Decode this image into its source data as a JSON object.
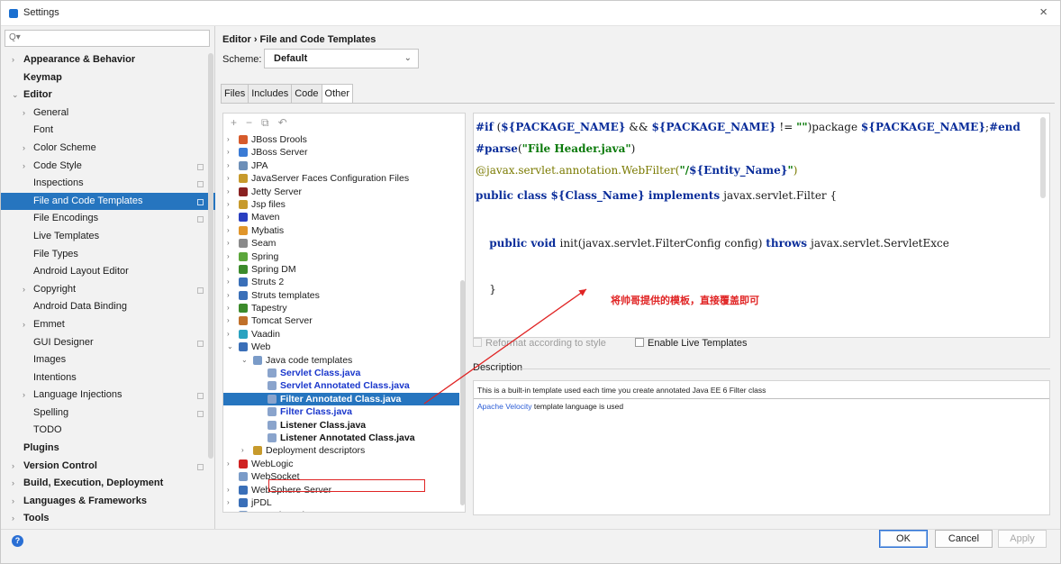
{
  "window": {
    "title": "Settings",
    "close": "×"
  },
  "search": {
    "icon": "Q▾",
    "placeholder": ""
  },
  "nav": [
    {
      "label": "Appearance & Behavior",
      "level": 0,
      "arrow": "›",
      "bold": true
    },
    {
      "label": "Keymap",
      "level": 0,
      "arrow": "",
      "bold": true
    },
    {
      "label": "Editor",
      "level": 0,
      "arrow": "⌄",
      "bold": true
    },
    {
      "label": "General",
      "level": 1,
      "arrow": "›"
    },
    {
      "label": "Font",
      "level": 1,
      "arrow": ""
    },
    {
      "label": "Color Scheme",
      "level": 1,
      "arrow": "›"
    },
    {
      "label": "Code Style",
      "level": 1,
      "arrow": "›",
      "copy": true
    },
    {
      "label": "Inspections",
      "level": 1,
      "arrow": "",
      "copy": true
    },
    {
      "label": "File and Code Templates",
      "level": 1,
      "arrow": "",
      "copy": true,
      "selected": true
    },
    {
      "label": "File Encodings",
      "level": 1,
      "arrow": "",
      "copy": true
    },
    {
      "label": "Live Templates",
      "level": 1,
      "arrow": ""
    },
    {
      "label": "File Types",
      "level": 1,
      "arrow": ""
    },
    {
      "label": "Android Layout Editor",
      "level": 1,
      "arrow": ""
    },
    {
      "label": "Copyright",
      "level": 1,
      "arrow": "›",
      "copy": true
    },
    {
      "label": "Android Data Binding",
      "level": 1,
      "arrow": ""
    },
    {
      "label": "Emmet",
      "level": 1,
      "arrow": "›"
    },
    {
      "label": "GUI Designer",
      "level": 1,
      "arrow": "",
      "copy": true
    },
    {
      "label": "Images",
      "level": 1,
      "arrow": ""
    },
    {
      "label": "Intentions",
      "level": 1,
      "arrow": ""
    },
    {
      "label": "Language Injections",
      "level": 1,
      "arrow": "›",
      "copy": true
    },
    {
      "label": "Spelling",
      "level": 1,
      "arrow": "",
      "copy": true
    },
    {
      "label": "TODO",
      "level": 1,
      "arrow": ""
    },
    {
      "label": "Plugins",
      "level": 0,
      "arrow": "",
      "bold": true
    },
    {
      "label": "Version Control",
      "level": 0,
      "arrow": "›",
      "bold": true,
      "copy": true
    },
    {
      "label": "Build, Execution, Deployment",
      "level": 0,
      "arrow": "›",
      "bold": true
    },
    {
      "label": "Languages & Frameworks",
      "level": 0,
      "arrow": "›",
      "bold": true
    },
    {
      "label": "Tools",
      "level": 0,
      "arrow": "›",
      "bold": true
    }
  ],
  "header": {
    "breadcrumb": "Editor  ›  File and Code Templates",
    "scheme_label": "Scheme:",
    "scheme_value": "Default",
    "scheme_chevron": "⌄"
  },
  "tabs": [
    "Files",
    "Includes",
    "Code",
    "Other"
  ],
  "active_tab": "Other",
  "tree_toolbar": [
    "+",
    "−",
    "⧉",
    "↶"
  ],
  "tree": [
    {
      "label": "JBoss Drools",
      "level": 0,
      "arrow": "›",
      "icon_color": "#d65a2b"
    },
    {
      "label": "JBoss Server",
      "level": 0,
      "arrow": "›",
      "icon_color": "#3a7bd5"
    },
    {
      "label": "JPA",
      "level": 0,
      "arrow": "›",
      "icon_color": "#6d8fb8"
    },
    {
      "label": "JavaServer Faces Configuration Files",
      "level": 0,
      "arrow": "›",
      "icon_color": "#c79a2c"
    },
    {
      "label": "Jetty Server",
      "level": 0,
      "arrow": "›",
      "icon_color": "#8a2222"
    },
    {
      "label": "Jsp files",
      "level": 0,
      "arrow": "›",
      "icon_color": "#c79a2c"
    },
    {
      "label": "Maven",
      "level": 0,
      "arrow": "›",
      "icon_color": "#2a3fc0"
    },
    {
      "label": "Mybatis",
      "level": 0,
      "arrow": "›",
      "icon_color": "#e0952a"
    },
    {
      "label": "Seam",
      "level": 0,
      "arrow": "›",
      "icon_color": "#8a8a8a"
    },
    {
      "label": "Spring",
      "level": 0,
      "arrow": "›",
      "icon_color": "#5ba63b"
    },
    {
      "label": "Spring DM",
      "level": 0,
      "arrow": "›",
      "icon_color": "#3b8a2b"
    },
    {
      "label": "Struts 2",
      "level": 0,
      "arrow": "›",
      "icon_color": "#3a6fb8"
    },
    {
      "label": "Struts templates",
      "level": 0,
      "arrow": "›",
      "icon_color": "#3a6fb8"
    },
    {
      "label": "Tapestry",
      "level": 0,
      "arrow": "›",
      "icon_color": "#3b8a2b"
    },
    {
      "label": "Tomcat Server",
      "level": 0,
      "arrow": "›",
      "icon_color": "#c0702a"
    },
    {
      "label": "Vaadin",
      "level": 0,
      "arrow": "›",
      "icon_color": "#2aa2c0"
    },
    {
      "label": "Web",
      "level": 0,
      "arrow": "⌄",
      "icon_color": "#3a6fb8"
    },
    {
      "label": "Java code templates",
      "level": 1,
      "arrow": "⌄",
      "icon_color": "#7a9bc8"
    },
    {
      "label": "Servlet Class.java",
      "level": 2,
      "arrow": "",
      "icon_color": "#8aa4cc",
      "kind": "file"
    },
    {
      "label": "Servlet Annotated Class.java",
      "level": 2,
      "arrow": "",
      "icon_color": "#8aa4cc",
      "kind": "file"
    },
    {
      "label": "Filter Annotated Class.java",
      "level": 2,
      "arrow": "",
      "icon_color": "#8aa4cc",
      "kind": "file",
      "selected": true
    },
    {
      "label": "Filter Class.java",
      "level": 2,
      "arrow": "",
      "icon_color": "#8aa4cc",
      "kind": "file"
    },
    {
      "label": "Listener Class.java",
      "level": 2,
      "arrow": "",
      "icon_color": "#8aa4cc",
      "kind": "bfile"
    },
    {
      "label": "Listener Annotated Class.java",
      "level": 2,
      "arrow": "",
      "icon_color": "#8aa4cc",
      "kind": "bfile"
    },
    {
      "label": "Deployment descriptors",
      "level": 1,
      "arrow": "›",
      "icon_color": "#c79a2c"
    },
    {
      "label": "WebLogic",
      "level": 0,
      "arrow": "›",
      "icon_color": "#d02222"
    },
    {
      "label": "WebSocket",
      "level": 0,
      "arrow": "",
      "icon_color": "#7a9bc8"
    },
    {
      "label": "WebSphere Server",
      "level": 0,
      "arrow": "›",
      "icon_color": "#3a6fb8"
    },
    {
      "label": "jPDL",
      "level": 0,
      "arrow": "›",
      "icon_color": "#3a6fb8"
    },
    {
      "label": "restwebservices",
      "level": 0,
      "arrow": "›",
      "icon_color": "#7a9bc8"
    }
  ],
  "editor": {
    "lines": [
      {
        "parts": [
          [
            "kw",
            "#if"
          ],
          [
            "",
            " ("
          ],
          [
            "kw",
            "${PACKAGE_NAME}"
          ],
          [
            "",
            " && "
          ],
          [
            "kw",
            "${PACKAGE_NAME}"
          ],
          [
            "",
            " != "
          ],
          [
            "str",
            "\"\""
          ],
          [
            "",
            ")package "
          ],
          [
            "kw",
            "${PACKAGE_NAME}"
          ],
          [
            "",
            ";"
          ],
          [
            "kw",
            "#end"
          ]
        ]
      },
      {
        "parts": [
          [
            "kw",
            "#parse"
          ],
          [
            "",
            "("
          ],
          [
            "str",
            "\"File Header.java\""
          ],
          [
            "",
            ")"
          ]
        ]
      },
      {
        "parts": [
          [
            "anno",
            "@javax.servlet.annotation.WebFilter("
          ],
          [
            "str",
            "\"/"
          ],
          [
            "kw",
            "${Entity_Name}"
          ],
          [
            "str",
            "\""
          ],
          [
            "anno",
            ")"
          ]
        ]
      },
      {
        "parts": [
          [
            "kw",
            "public class "
          ],
          [
            "kw",
            "${Class_Name}"
          ],
          [
            "kw",
            " implements "
          ],
          [
            "",
            "javax.servlet.Filter {"
          ]
        ]
      },
      {
        "parts": []
      },
      {
        "parts": [
          [
            "",
            "    "
          ],
          [
            "kw",
            "public void "
          ],
          [
            "",
            "init(javax.servlet.FilterConfig config) "
          ],
          [
            "kw",
            "throws "
          ],
          [
            "",
            "javax.servlet.ServletExce"
          ]
        ]
      },
      {
        "parts": []
      },
      {
        "parts": [
          [
            "",
            "    }"
          ]
        ]
      }
    ]
  },
  "annotation": {
    "text": "将帅哥提供的模板，直接覆盖即可",
    "color": "#e02424"
  },
  "options": {
    "reformat": "Reformat according to style",
    "live_templates": "Enable Live Templates"
  },
  "description": {
    "title": "Description",
    "line1": "This is a built-in template used each time you create annotated Java EE 6 Filter class",
    "link": "Apache Velocity",
    "line2_rest": " template language is used"
  },
  "buttons": {
    "ok": "OK",
    "cancel": "Cancel",
    "apply": "Apply",
    "help": "?"
  },
  "colors": {
    "accent": "#2675bf",
    "keyword": "#0a2d9a",
    "string": "#0b7a0b",
    "template_file": "#1a37cc",
    "annotation_red": "#e02424"
  }
}
